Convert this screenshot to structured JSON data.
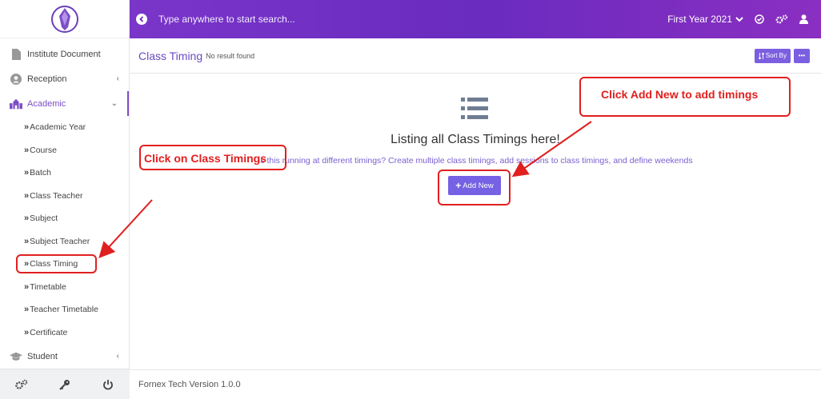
{
  "sidebar": {
    "items": [
      {
        "label": "Institute Document",
        "icon": "document-icon"
      },
      {
        "label": "Reception",
        "icon": "user-circle-icon",
        "caret": "‹"
      },
      {
        "label": "Academic",
        "icon": "school-icon",
        "caret": "⌄",
        "active": true
      }
    ],
    "subitems": [
      {
        "label": "Academic Year"
      },
      {
        "label": "Course"
      },
      {
        "label": "Batch"
      },
      {
        "label": "Class Teacher"
      },
      {
        "label": "Subject"
      },
      {
        "label": "Subject Teacher"
      },
      {
        "label": "Class Timing",
        "highlighted": true
      },
      {
        "label": "Timetable"
      },
      {
        "label": "Teacher Timetable"
      },
      {
        "label": "Certificate"
      }
    ],
    "student": {
      "label": "Student",
      "caret": "‹"
    },
    "chevron": "»"
  },
  "topbar": {
    "search_placeholder": "Type anywhere to start search...",
    "year": "First Year 2021",
    "gradient": [
      "#7a35c9",
      "#8a2fc2"
    ]
  },
  "page": {
    "title": "Class Timing",
    "subtitle": "No result found",
    "sort_label": "Sort By",
    "more_label": "•••"
  },
  "empty": {
    "title": "Listing all Class Timings here!",
    "description": "Is this running at different timings? Create multiple class timings, add sessions to class timings, and define weekends",
    "add_label": "Add New"
  },
  "footer": {
    "version": "Fornex Tech Version 1.0.0"
  },
  "annotations": {
    "class_timings": "Click on Class Timings",
    "add_new": "Click Add New to add timings",
    "color": "#e0201f"
  },
  "colors": {
    "accent": "#7d4fc6",
    "button": "#7561e3"
  }
}
